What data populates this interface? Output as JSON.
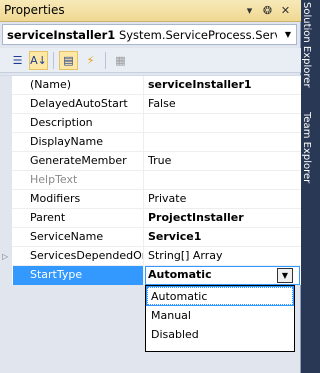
{
  "window": {
    "title": "Properties",
    "pin_glyph": "❂",
    "close_glyph": "✕",
    "menu_glyph": "▾"
  },
  "selector": {
    "object_name": "serviceInstaller1",
    "object_type": "System.ServiceProcess.ServiceIns"
  },
  "toolbar": {
    "categorized_glyph": "☰",
    "alphabetical_glyph": "A↓",
    "properties_glyph": "▤",
    "events_glyph": "⚡",
    "pages_glyph": "▦"
  },
  "properties": [
    {
      "name": "(Name)",
      "value": "serviceInstaller1",
      "bold": true
    },
    {
      "name": "DelayedAutoStart",
      "value": "False",
      "bold": false
    },
    {
      "name": "Description",
      "value": "",
      "bold": false
    },
    {
      "name": "DisplayName",
      "value": "",
      "bold": false
    },
    {
      "name": "GenerateMember",
      "value": "True",
      "bold": false
    },
    {
      "name": "HelpText",
      "value": "",
      "bold": false,
      "dim": true
    },
    {
      "name": "Modifiers",
      "value": "Private",
      "bold": false
    },
    {
      "name": "Parent",
      "value": "ProjectInstaller",
      "bold": true
    },
    {
      "name": "ServiceName",
      "value": "Service1",
      "bold": true
    },
    {
      "name": "ServicesDependedOn",
      "value": "String[] Array",
      "bold": false,
      "expandable": true
    },
    {
      "name": "StartType",
      "value": "Automatic",
      "bold": true,
      "selected": true
    }
  ],
  "dropdown": {
    "options": [
      "Automatic",
      "Manual",
      "Disabled"
    ],
    "selected": "Automatic"
  },
  "side_tabs": [
    "Solution Explorer",
    "Team Explorer"
  ],
  "colors": {
    "accent": "#3399ff",
    "titlebar": "#f0d891",
    "background": "#293955"
  }
}
